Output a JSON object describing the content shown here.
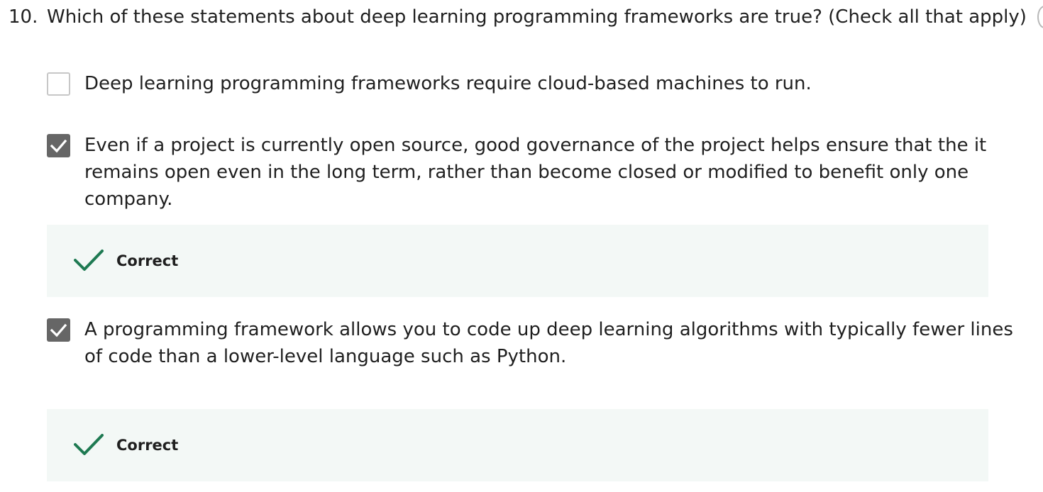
{
  "question": {
    "number": "10.",
    "text": "Which of these statements about deep learning programming frameworks are true? (Check all that apply)"
  },
  "options": [
    {
      "text": "Deep learning programming frameworks require cloud-based machines to run.",
      "checked": false
    },
    {
      "text": "Even if a project is currently open source, good governance of the project helps ensure that the it remains open even in the long term, rather than become closed or modified to benefit only one company.",
      "checked": true,
      "feedback": "Correct"
    },
    {
      "text": "A programming framework allows you to code up deep learning algorithms with typically fewer lines of code than a lower-level language such as Python.",
      "checked": true,
      "feedback": "Correct"
    }
  ],
  "colors": {
    "correct_green": "#1e7a52",
    "feedback_bg": "#f3f8f6",
    "checkbox_checked": "#666666"
  },
  "icons": {
    "checkbox_check": "checkmark-icon",
    "feedback_correct": "correct-check-icon"
  }
}
